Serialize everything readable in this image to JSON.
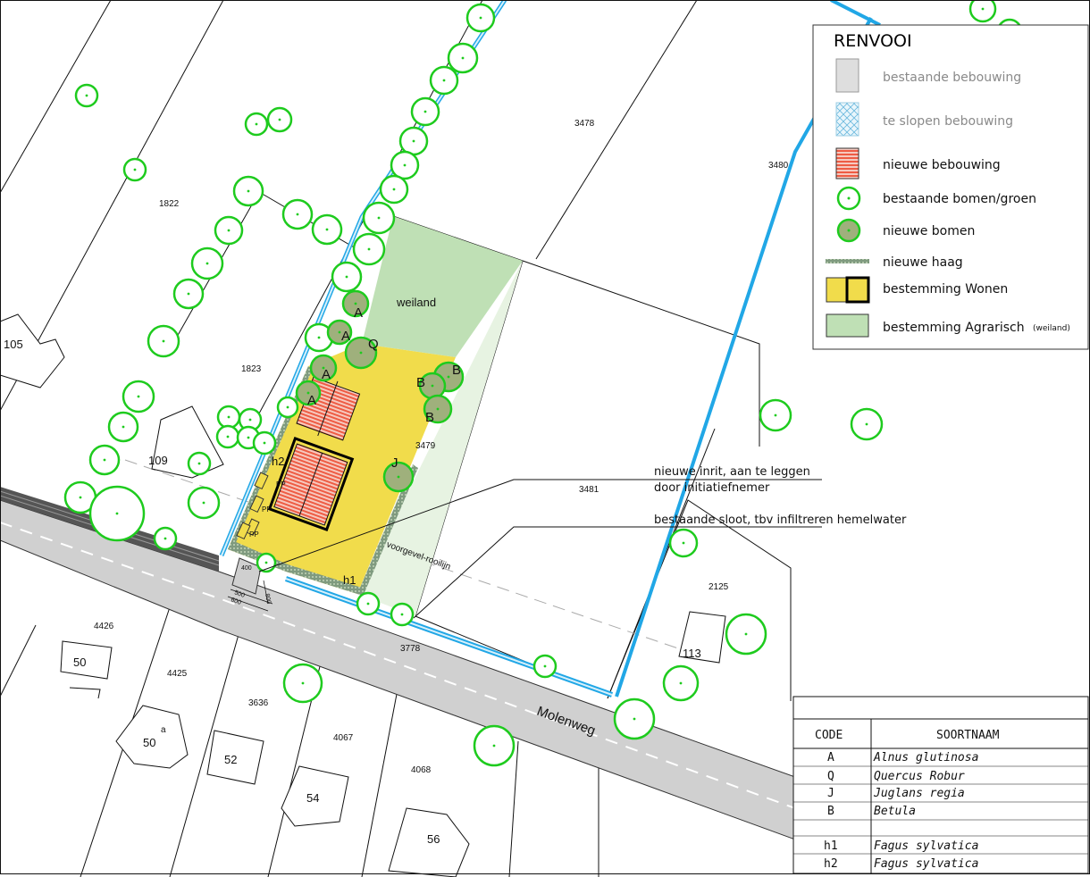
{
  "legend": {
    "title": "RENVOOI",
    "items": [
      {
        "key": "existing",
        "label": "bestaande bebouwing",
        "swatch": "#dedede"
      },
      {
        "key": "demolish",
        "label": "te slopen bebouwing",
        "swatch": "#cfe8f5"
      },
      {
        "key": "new_building",
        "label": "nieuwe bebouwing",
        "swatch": "#f08a7a"
      },
      {
        "key": "existing_trees",
        "label": "bestaande bomen/groen",
        "swatch": "#1ecb1e"
      },
      {
        "key": "new_trees",
        "label": "nieuwe bomen",
        "swatch": "#9fb07c"
      },
      {
        "key": "new_hedge",
        "label": "nieuwe haag",
        "swatch": "#7f9a7f"
      },
      {
        "key": "zone_living",
        "label": "bestemming Wonen",
        "swatch": "#f1dc4b"
      },
      {
        "key": "zone_agri",
        "label": "bestemming Agrarisch",
        "suffix": "(weiland)",
        "swatch": "#bfe0b5"
      }
    ]
  },
  "parcels": [
    "1822",
    "1823",
    "3478",
    "3480",
    "3479",
    "3481",
    "2125",
    "3778",
    "4426",
    "4425",
    "3636",
    "4067",
    "4068",
    "105",
    "109",
    "113"
  ],
  "house_numbers": [
    "50",
    "50",
    "52",
    "54",
    "56"
  ],
  "house_suffix": "a",
  "street": "Molenweg",
  "field_label": "weiland",
  "facade_line": "voorgevel-rooilijn",
  "tree_codes": {
    "A": "A",
    "Q": "Q",
    "B": "B",
    "J": "J",
    "h1": "h1",
    "h2": "h2",
    "pp": "PP"
  },
  "dimensions": [
    "400",
    "500",
    "600",
    "800"
  ],
  "annotations": {
    "driveway_line1": "nieuwe inrit, aan te leggen",
    "driveway_line2": "door initiatiefnemer",
    "ditch": "bestaande sloot, tbv infiltreren hemelwater"
  },
  "species_table": {
    "headers": {
      "code": "CODE",
      "name": "SOORTNAAM"
    },
    "rows": [
      {
        "code": "A",
        "name": "Alnus glutinosa"
      },
      {
        "code": "Q",
        "name": "Quercus Robur"
      },
      {
        "code": "J",
        "name": "Juglans regia"
      },
      {
        "code": "B",
        "name": "Betula"
      },
      {
        "code": "",
        "name": ""
      },
      {
        "code": "h1",
        "name": "Fagus sylvatica"
      },
      {
        "code": "h2",
        "name": "Fagus sylvatica"
      }
    ]
  }
}
